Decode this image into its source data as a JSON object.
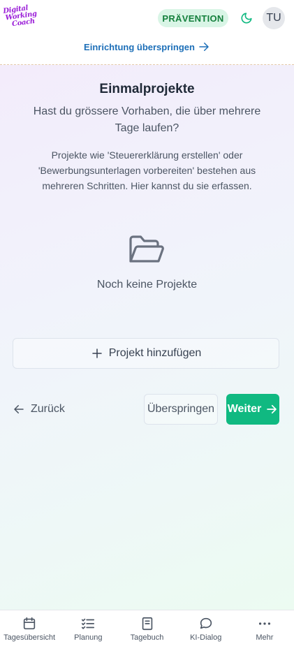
{
  "header": {
    "logo": [
      "Digital",
      "Working",
      "Coach"
    ],
    "badge": "PRÄVENTION",
    "avatar": "TU",
    "skip_link": "Einrichtung überspringen",
    "icons": {
      "theme": "moon-icon",
      "skip": "arrow-right-icon"
    }
  },
  "main": {
    "title": "Einmalprojekte",
    "question": "Hast du grössere Vorhaben, die über mehrere Tage laufen?",
    "description": "Projekte wie 'Steuererklärung erstellen' oder 'Bewerbungsunterlagen vorbereiten' bestehen aus mehreren Schritten. Hier kannst du sie erfassen.",
    "empty_icon": "folder-open-icon",
    "empty_text": "Noch keine Projekte",
    "add_button": "Projekt hinzufügen"
  },
  "footer_actions": {
    "back": "Zurück",
    "skip": "Überspringen",
    "next": "Weiter"
  },
  "bottom_nav": [
    {
      "label": "Tagesübersicht",
      "icon": "calendar-icon"
    },
    {
      "label": "Planung",
      "icon": "checklist-icon"
    },
    {
      "label": "Tagebuch",
      "icon": "book-icon"
    },
    {
      "label": "KI-Dialog",
      "icon": "chat-icon"
    },
    {
      "label": "Mehr",
      "icon": "more-icon"
    }
  ],
  "colors": {
    "accent": "#10b981",
    "badge_bg": "#d9f5e6",
    "badge_text": "#15803d",
    "link": "#1d6fb8",
    "logo": "#9b1fd8"
  }
}
